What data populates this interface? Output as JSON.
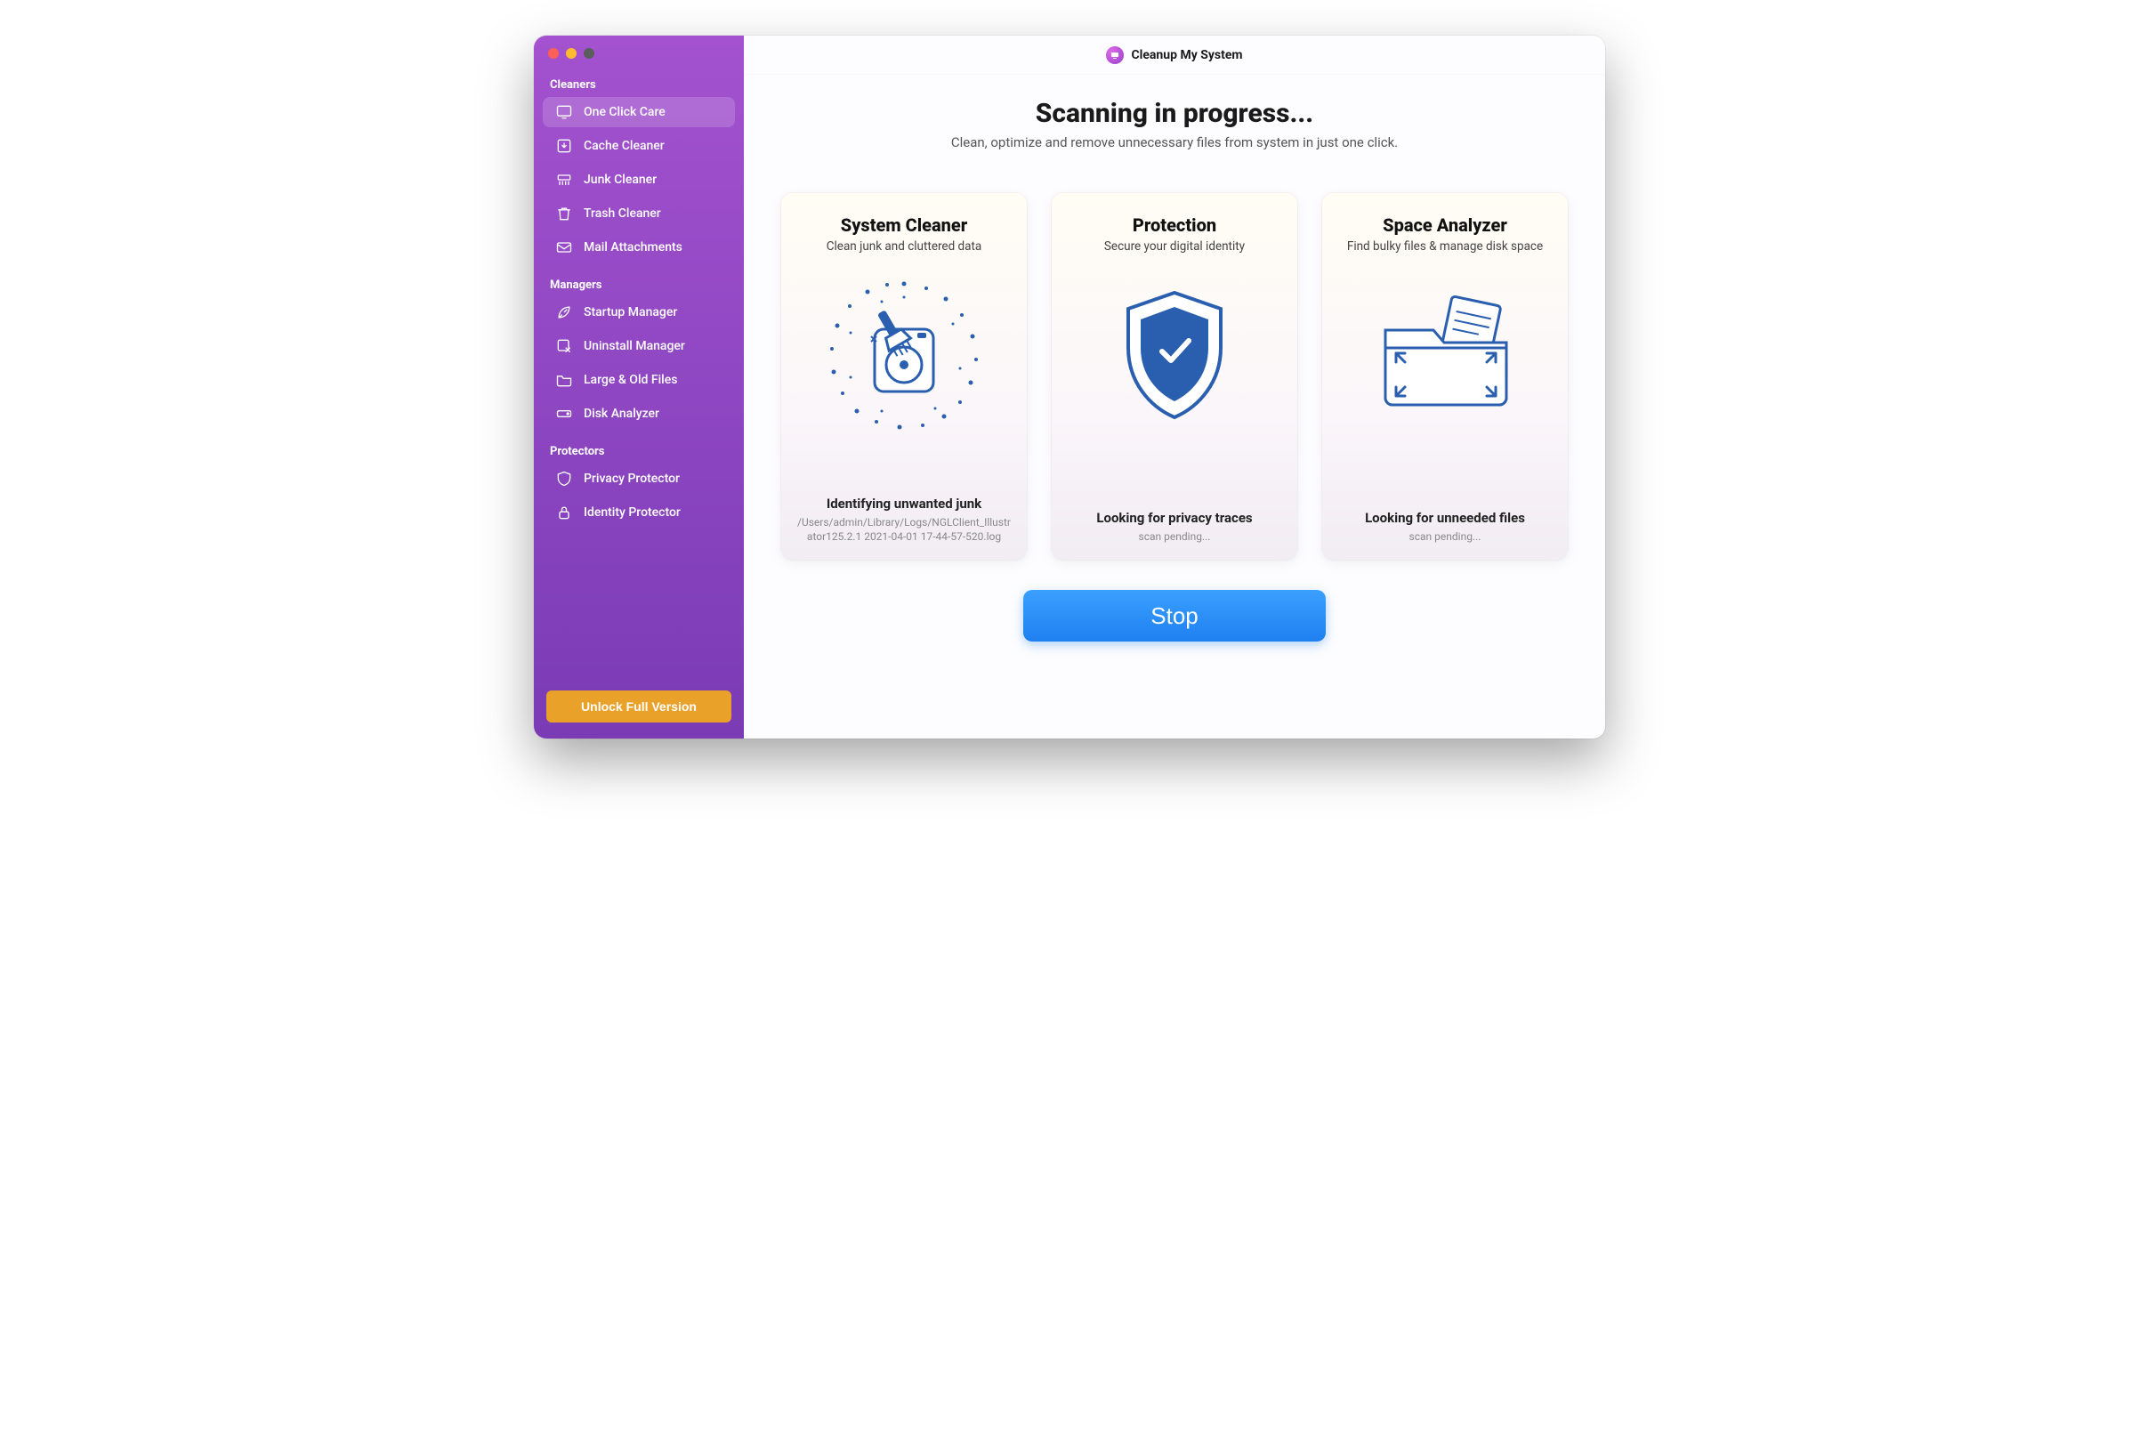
{
  "app": {
    "title": "Cleanup My System"
  },
  "sidebar": {
    "sections": [
      {
        "label": "Cleaners",
        "items": [
          {
            "label": "One Click Care",
            "active": true
          },
          {
            "label": "Cache Cleaner"
          },
          {
            "label": "Junk Cleaner"
          },
          {
            "label": "Trash Cleaner"
          },
          {
            "label": "Mail Attachments"
          }
        ]
      },
      {
        "label": "Managers",
        "items": [
          {
            "label": "Startup Manager"
          },
          {
            "label": "Uninstall Manager"
          },
          {
            "label": "Large & Old Files"
          },
          {
            "label": "Disk Analyzer"
          }
        ]
      },
      {
        "label": "Protectors",
        "items": [
          {
            "label": "Privacy Protector"
          },
          {
            "label": "Identity Protector"
          }
        ]
      }
    ],
    "unlock_label": "Unlock Full Version"
  },
  "hero": {
    "title": "Scanning in progress...",
    "subtitle": "Clean, optimize and remove unnecessary files from system in just one click."
  },
  "cards": [
    {
      "title": "System Cleaner",
      "subtitle": "Clean junk and cluttered data",
      "status_title": "Identifying unwanted junk",
      "status_detail": "/Users/admin/Library/Logs/NGLClient_Illustrator125.2.1 2021-04-01 17-44-57-520.log"
    },
    {
      "title": "Protection",
      "subtitle": "Secure your digital identity",
      "status_title": "Looking for privacy traces",
      "status_detail": "scan pending..."
    },
    {
      "title": "Space Analyzer",
      "subtitle": "Find bulky files & manage disk space",
      "status_title": "Looking for unneeded files",
      "status_detail": "scan pending..."
    }
  ],
  "action": {
    "stop_label": "Stop"
  }
}
